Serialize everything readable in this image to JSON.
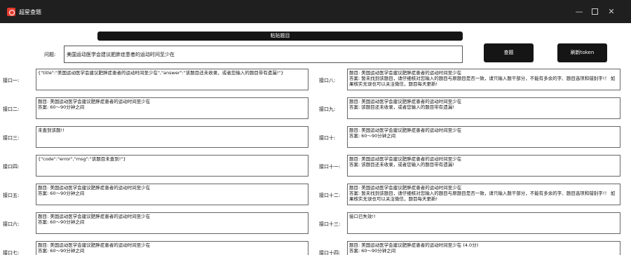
{
  "window": {
    "title": "超星查题"
  },
  "header": {
    "paste_label": "粘贴题目"
  },
  "question": {
    "label": "问题:",
    "value": "美国运动医学会建议肥胖症患者的运动时间至少在"
  },
  "buttons": {
    "query": "查题",
    "refresh_token": "刷新token"
  },
  "left_interfaces": [
    {
      "label": "接口一:",
      "lines": [
        "{\"title\":\"美国运动医学会建议肥胖症患者的运动时间至少在\",\"answer\":\"该题目还未收录，或者您输入的题目带有遗漏!\"}"
      ]
    },
    {
      "label": "接口二:",
      "lines": [
        "题目: 美国运动医学会建议肥胖症患者的运动时间至少在",
        "答案: 60～90分钟之间"
      ]
    },
    {
      "label": "接口三:",
      "lines": [
        "未查到该题!!"
      ]
    },
    {
      "label": "接口四:",
      "lines": [
        "{\"code\":\"error\",\"msg\":\"该题目未查到!\"}"
      ]
    },
    {
      "label": "接口五:",
      "lines": [
        "题目: 美国运动医学会建议肥胖症患者的运动时间至少在",
        "答案: 60～90分钟之间"
      ]
    },
    {
      "label": "接口六:",
      "lines": [
        "题目: 美国运动医学会建议肥胖症患者的运动时间至少在",
        "答案: 60～90分钟之间"
      ]
    },
    {
      "label": "接口七:",
      "lines": [
        "题目: 美国运动医学会建议肥胖症患者的运动时间至少在",
        "答案: 60～90分钟之间"
      ]
    }
  ],
  "right_interfaces": [
    {
      "label": "接口八:",
      "lines": [
        "题目: 美国运动医学会建议肥胖症患者的运动时间至少在",
        "答案: 暂未找到该题目，请仔细核对您输入的题目与原题目是否一致，请只输入题干部分，不能有多余的字、题目选项和错别字!！ 如果核实无误也可以关注微信，题目每天更新!"
      ]
    },
    {
      "label": "接口九:",
      "lines": [
        "题目: 美国运动医学会建议肥胖症患者的运动时间至少在",
        "答案: 该题目还未收录，或者您输入的题目带有遗漏!"
      ]
    },
    {
      "label": "接口十:",
      "lines": [
        "题目: 美国运动医学会建议肥胖症患者的运动时间至少在",
        "答案: 60～90分钟之间"
      ]
    },
    {
      "label": "接口十一:",
      "lines": [
        "题目: 美国运动医学会建议肥胖症患者的运动时间至少在",
        "答案: 该题目还未收录，或者您输入的题目带有遗漏!"
      ]
    },
    {
      "label": "接口十二:",
      "lines": [
        "题目: 美国运动医学会建议肥胖症患者的运动时间至少在",
        "答案: 暂未找到该题目，请仔细核对您输入的题目与原题目是否一致，请只输入题干部分，不能有多余的字、题目选项和错别字!！ 如果核实无误也可以关注微信，题目每天更新!"
      ]
    },
    {
      "label": "接口十三:",
      "lines": [
        "接口已失效!!"
      ]
    },
    {
      "label": "接口十四:",
      "lines": [
        "题目: 美国运动医学会建议肥胖症患者的运动时间至少在 (4.0分)",
        "答案: 60～90分钟之间"
      ]
    }
  ]
}
